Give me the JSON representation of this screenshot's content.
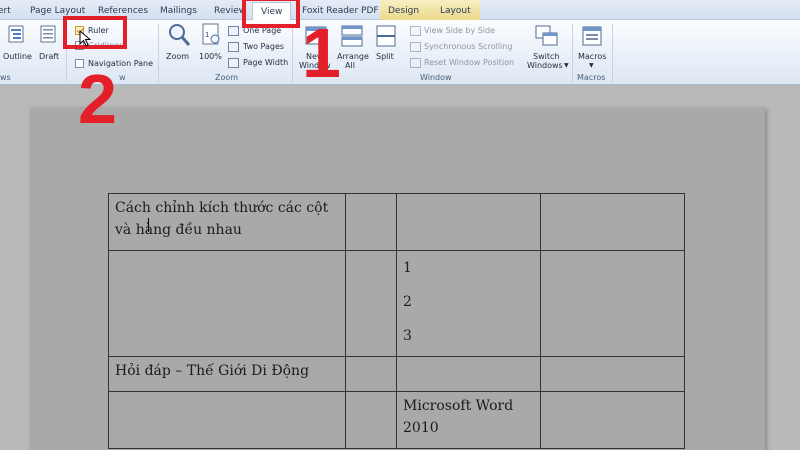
{
  "tabs": [
    {
      "label": "ert"
    },
    {
      "label": "Page Layout"
    },
    {
      "label": "References"
    },
    {
      "label": "Mailings"
    },
    {
      "label": "Review"
    },
    {
      "label": "View",
      "active": true
    },
    {
      "label": "Foxit Reader PDF"
    },
    {
      "label": "Design"
    },
    {
      "label": "Layout"
    }
  ],
  "ribbon": {
    "views": {
      "outline": "Outline",
      "draft": "Draft",
      "group_label": "ws"
    },
    "show": {
      "ruler": "Ruler",
      "gridlines": "Gridlines",
      "navigation_pane": "Navigation Pane",
      "group_label": "w"
    },
    "zoom": {
      "zoom": "Zoom",
      "percent": "100%",
      "one_page": "One Page",
      "two_pages": "Two Pages",
      "page_width": "Page Width",
      "group_label": "Zoom"
    },
    "window": {
      "new_window_1": "New",
      "new_window_2": "Window",
      "arrange_1": "Arrange",
      "arrange_2": "All",
      "split": "Split",
      "side_by_side": "View Side by Side",
      "sync_scroll": "Synchronous Scrolling",
      "reset_pos": "Reset Window Position",
      "switch_1": "Switch",
      "switch_2": "Windows",
      "group_label": "Window"
    },
    "macros": {
      "macros": "Macros",
      "group_label": "Macros"
    }
  },
  "annotations": {
    "step1": "1",
    "step2": "2"
  },
  "table": {
    "rows": [
      [
        "Cách chỉnh kích thước các cột và hàng đều nhau",
        "",
        "",
        ""
      ],
      [
        "",
        "",
        "1\n2\n3",
        ""
      ],
      [
        "Hỏi đáp – Thế Giới Di Động",
        "",
        "",
        ""
      ],
      [
        "",
        "",
        "Microsoft Word 2010",
        ""
      ]
    ]
  },
  "colors": {
    "annotation_red": "#e3202a"
  }
}
